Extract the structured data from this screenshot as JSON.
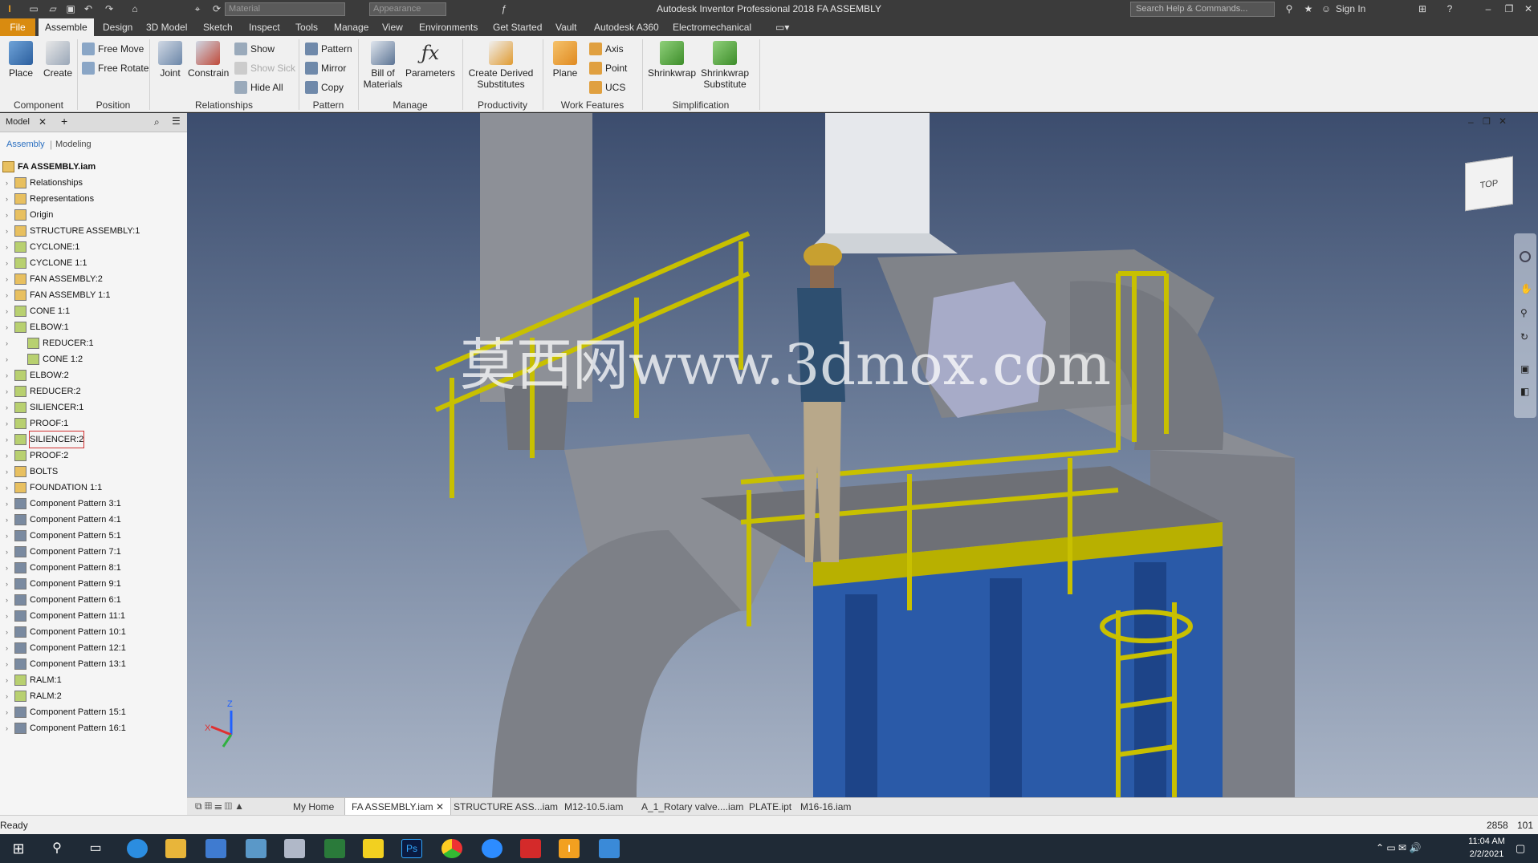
{
  "window": {
    "title": "Autodesk Inventor Professional 2018   FA ASSEMBLY",
    "search_placeholder": "Search Help & Commands...",
    "sign_in": "Sign In",
    "material_combo": "Material",
    "appearance_combo": "Appearance"
  },
  "menu": [
    "File",
    "Assemble",
    "Design",
    "3D Model",
    "Sketch",
    "Inspect",
    "Tools",
    "Manage",
    "View",
    "Environments",
    "Get Started",
    "Vault",
    "Autodesk A360",
    "Electromechanical"
  ],
  "ribbon": {
    "place": "Place",
    "create": "Create",
    "free_move": "Free Move",
    "free_rotate": "Free Rotate",
    "joint": "Joint",
    "constrain": "Constrain",
    "show": "Show",
    "show_sick": "Show Sick",
    "hide_all": "Hide All",
    "pattern": "Pattern",
    "mirror": "Mirror",
    "copy": "Copy",
    "bom": "Bill of Materials",
    "parameters": "Parameters",
    "derived": "Create Derived Substitutes",
    "plane": "Plane",
    "axis": "Axis",
    "point": "Point",
    "ucs": "UCS",
    "shrinkwrap": "Shrinkwrap",
    "shrinkwrap_sub": "Shrinkwrap Substitute",
    "groups": {
      "component": "Component",
      "position": "Position",
      "relationships": "Relationships",
      "pattern": "Pattern",
      "manage": "Manage",
      "productivity": "Productivity",
      "work_features": "Work Features",
      "simplification": "Simplification"
    }
  },
  "browser": {
    "tab": "Model",
    "mode_assembly": "Assembly",
    "mode_modeling": "Modeling",
    "root": "FA ASSEMBLY.iam",
    "items": [
      "Relationships",
      "Representations",
      "Origin",
      "STRUCTURE ASSEMBLY:1",
      "CYCLONE:1",
      "CYCLONE 1:1",
      "FAN ASSEMBLY:2",
      "FAN ASSEMBLY 1:1",
      "CONE 1:1",
      "ELBOW:1",
      "REDUCER:1",
      "CONE 1:2",
      "ELBOW:2",
      "REDUCER:2",
      "SILIENCER:1",
      "PROOF:1",
      "SILIENCER:2",
      "PROOF:2",
      "BOLTS",
      "FOUNDATION 1:1",
      "Component Pattern 3:1",
      "Component Pattern 4:1",
      "Component Pattern 5:1",
      "Component Pattern 7:1",
      "Component Pattern 8:1",
      "Component Pattern 9:1",
      "Component Pattern 6:1",
      "Component Pattern 11:1",
      "Component Pattern 10:1",
      "Component Pattern 12:1",
      "Component Pattern 13:1",
      "RALM:1",
      "RALM:2",
      "Component Pattern 15:1",
      "Component Pattern 16:1"
    ]
  },
  "viewport": {
    "watermark": "莫西网www.3dmox.com",
    "viewcube_face": "TOP"
  },
  "doc_tabs": [
    "My Home",
    "FA ASSEMBLY.iam",
    "STRUCTURE ASS...iam",
    "M12-10.5.iam",
    "A_1_Rotary valve....iam",
    "PLATE.ipt",
    "M16-16.iam"
  ],
  "status": {
    "text": "Ready",
    "count1": "2858",
    "count2": "101"
  },
  "taskbar": {
    "time": "11:04 AM",
    "date": "2/2/2021"
  },
  "colors": {
    "accent": "#d98b10",
    "steel_blue": "#2a5aa8",
    "railing_yellow": "#c8c000",
    "duct_grey": "#8a8d93"
  }
}
